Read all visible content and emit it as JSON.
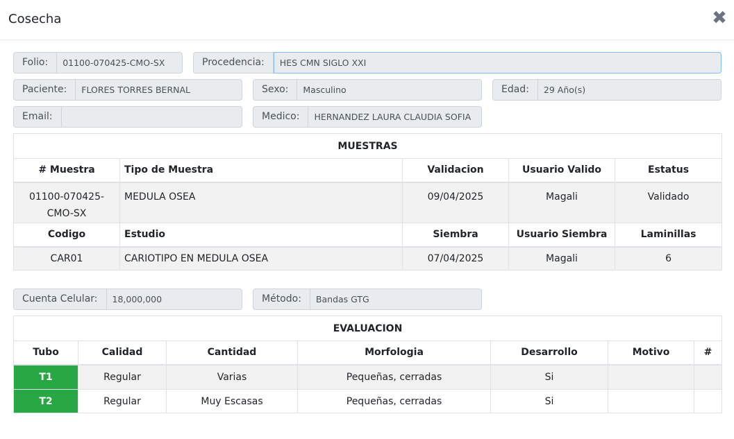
{
  "modal": {
    "title": "Cosecha",
    "close_glyph": "✖"
  },
  "fields": {
    "folio": {
      "label": "Folio:",
      "value": "01100-070425-CMO-SX"
    },
    "procedencia": {
      "label": "Procedencia:",
      "value": "HES CMN SIGLO XXI"
    },
    "paciente": {
      "label": "Paciente:",
      "value": "FLORES TORRES BERNAL"
    },
    "sexo": {
      "label": "Sexo:",
      "value": "Masculino"
    },
    "edad": {
      "label": "Edad:",
      "value": "29 Año(s)"
    },
    "email": {
      "label": "Email:",
      "value": ""
    },
    "medico": {
      "label": "Medico:",
      "value": "HERNANDEZ LAURA CLAUDIA SOFIA"
    },
    "cuenta_celular": {
      "label": "Cuenta Celular:",
      "value": "18,000,000"
    },
    "metodo": {
      "label": "Método:",
      "value": "Bandas GTG"
    }
  },
  "muestras": {
    "title": "MUESTRAS",
    "headers": [
      "# Muestra",
      "Tipo de Muestra",
      "Validacion",
      "Usuario Valido",
      "Estatus"
    ],
    "row": {
      "muestra_line1": "01100-070425-",
      "muestra_line2": "CMO-SX",
      "tipo": "MEDULA OSEA",
      "validacion": "09/04/2025",
      "usuario_valido": "Magali",
      "estatus": "Validado"
    },
    "headers2": [
      "Codigo",
      "Estudio",
      "Siembra",
      "Usuario Siembra",
      "Laminillas"
    ],
    "row2": {
      "codigo": "CAR01",
      "estudio": "CARIOTIPO EN MEDULA OSEA",
      "siembra": "07/04/2025",
      "usuario_siembra": "Magali",
      "laminillas": "6"
    }
  },
  "evaluacion": {
    "title": "EVALUACION",
    "headers": [
      "Tubo",
      "Calidad",
      "Cantidad",
      "Morfologia",
      "Desarrollo",
      "Motivo",
      "#"
    ],
    "rows": [
      {
        "tubo": "T1",
        "calidad": "Regular",
        "cantidad": "Varias",
        "morfologia": "Pequeñas, cerradas",
        "desarrollo": "Si",
        "motivo": "",
        "num": ""
      },
      {
        "tubo": "T2",
        "calidad": "Regular",
        "cantidad": "Muy Escasas",
        "morfologia": "Pequeñas, cerradas",
        "desarrollo": "Si",
        "motivo": "",
        "num": ""
      }
    ]
  },
  "colors": {
    "tubo_green": "#28a745",
    "row_gray": "#f2f2f2",
    "addon_bg": "#e9ecef",
    "focus_border": "#80bdff"
  }
}
